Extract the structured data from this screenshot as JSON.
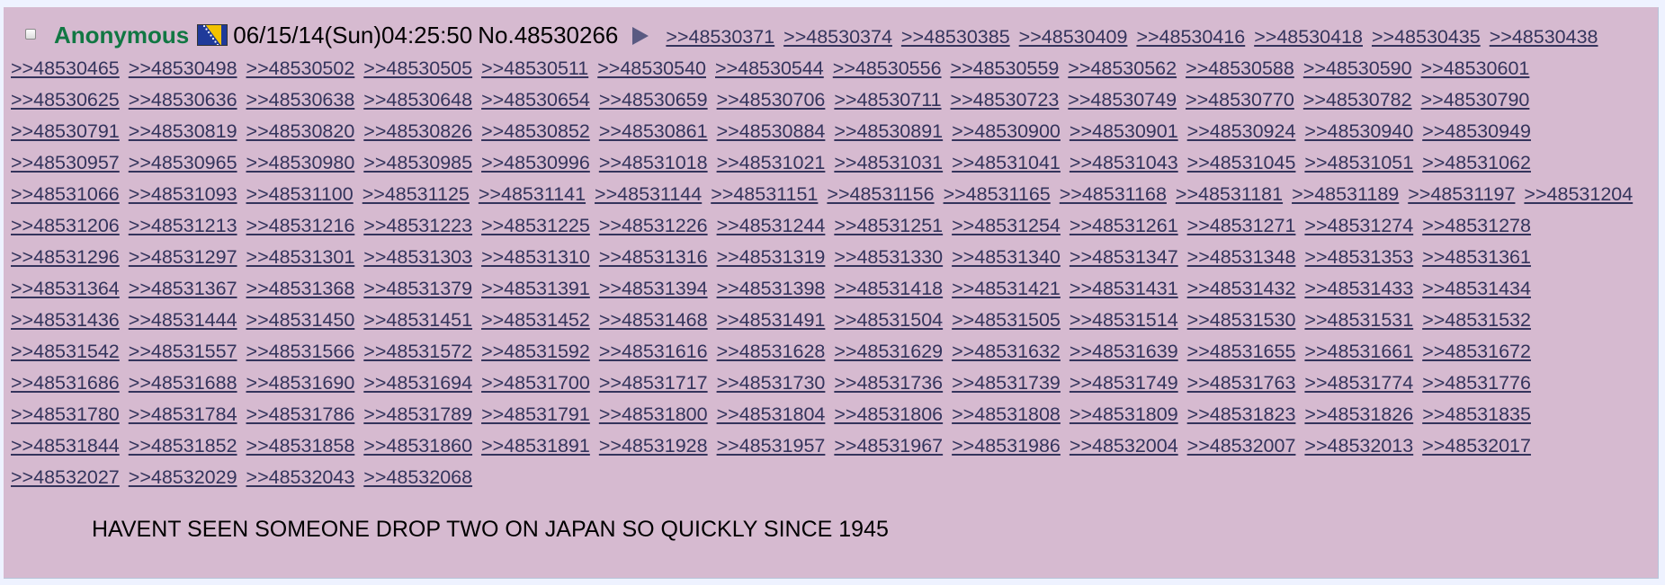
{
  "post": {
    "name": "Anonymous",
    "datetime": "06/15/14(Sun)04:25:50",
    "post_number": "No.48530266",
    "flag_icon": "bosnia-flag-icon",
    "backlinks": [
      ">>48530371",
      ">>48530374",
      ">>48530385",
      ">>48530409",
      ">>48530416",
      ">>48530418",
      ">>48530435",
      ">>48530438",
      ">>48530465",
      ">>48530498",
      ">>48530502",
      ">>48530505",
      ">>48530511",
      ">>48530540",
      ">>48530544",
      ">>48530556",
      ">>48530559",
      ">>48530562",
      ">>48530588",
      ">>48530590",
      ">>48530601",
      ">>48530625",
      ">>48530636",
      ">>48530638",
      ">>48530648",
      ">>48530654",
      ">>48530659",
      ">>48530706",
      ">>48530711",
      ">>48530723",
      ">>48530749",
      ">>48530770",
      ">>48530782",
      ">>48530790",
      ">>48530791",
      ">>48530819",
      ">>48530820",
      ">>48530826",
      ">>48530852",
      ">>48530861",
      ">>48530884",
      ">>48530891",
      ">>48530900",
      ">>48530901",
      ">>48530924",
      ">>48530940",
      ">>48530949",
      ">>48530957",
      ">>48530965",
      ">>48530980",
      ">>48530985",
      ">>48530996",
      ">>48531018",
      ">>48531021",
      ">>48531031",
      ">>48531041",
      ">>48531043",
      ">>48531045",
      ">>48531051",
      ">>48531062",
      ">>48531066",
      ">>48531093",
      ">>48531100",
      ">>48531125",
      ">>48531141",
      ">>48531144",
      ">>48531151",
      ">>48531156",
      ">>48531165",
      ">>48531168",
      ">>48531181",
      ">>48531189",
      ">>48531197",
      ">>48531204",
      ">>48531206",
      ">>48531213",
      ">>48531216",
      ">>48531223",
      ">>48531225",
      ">>48531226",
      ">>48531244",
      ">>48531251",
      ">>48531254",
      ">>48531261",
      ">>48531271",
      ">>48531274",
      ">>48531278",
      ">>48531296",
      ">>48531297",
      ">>48531301",
      ">>48531303",
      ">>48531310",
      ">>48531316",
      ">>48531319",
      ">>48531330",
      ">>48531340",
      ">>48531347",
      ">>48531348",
      ">>48531353",
      ">>48531361",
      ">>48531364",
      ">>48531367",
      ">>48531368",
      ">>48531379",
      ">>48531391",
      ">>48531394",
      ">>48531398",
      ">>48531418",
      ">>48531421",
      ">>48531431",
      ">>48531432",
      ">>48531433",
      ">>48531434",
      ">>48531436",
      ">>48531444",
      ">>48531450",
      ">>48531451",
      ">>48531452",
      ">>48531468",
      ">>48531491",
      ">>48531504",
      ">>48531505",
      ">>48531514",
      ">>48531530",
      ">>48531531",
      ">>48531532",
      ">>48531542",
      ">>48531557",
      ">>48531566",
      ">>48531572",
      ">>48531592",
      ">>48531616",
      ">>48531628",
      ">>48531629",
      ">>48531632",
      ">>48531639",
      ">>48531655",
      ">>48531661",
      ">>48531672",
      ">>48531686",
      ">>48531688",
      ">>48531690",
      ">>48531694",
      ">>48531700",
      ">>48531717",
      ">>48531730",
      ">>48531736",
      ">>48531739",
      ">>48531749",
      ">>48531763",
      ">>48531774",
      ">>48531776",
      ">>48531780",
      ">>48531784",
      ">>48531786",
      ">>48531789",
      ">>48531791",
      ">>48531800",
      ">>48531804",
      ">>48531806",
      ">>48531808",
      ">>48531809",
      ">>48531823",
      ">>48531826",
      ">>48531835",
      ">>48531844",
      ">>48531852",
      ">>48531858",
      ">>48531860",
      ">>48531891",
      ">>48531928",
      ">>48531957",
      ">>48531967",
      ">>48531986",
      ">>48532004",
      ">>48532007",
      ">>48532013",
      ">>48532017",
      ">>48532027",
      ">>48532029",
      ">>48532043",
      ">>48532068"
    ],
    "message": "HAVENT SEEN SOMEONE DROP TWO ON JAPAN SO QUICKLY SINCE 1945"
  },
  "colors": {
    "post_background": "#d6bad0",
    "name": "#117743",
    "link": "#34345c"
  }
}
